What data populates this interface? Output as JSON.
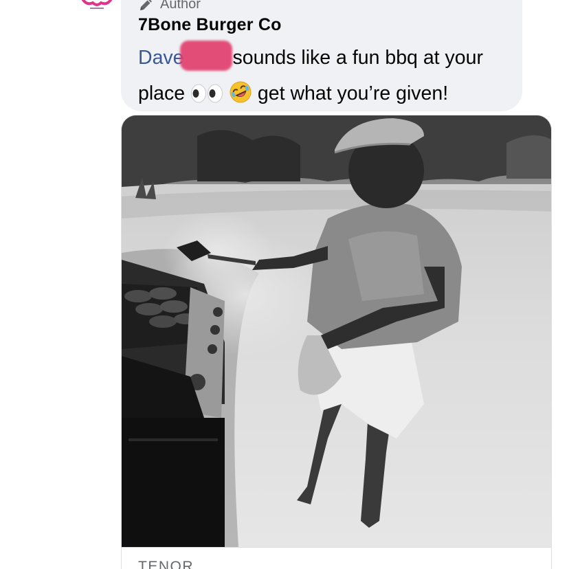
{
  "comment": {
    "badge_label": "Author",
    "author": "7Bone Burger Co",
    "mention": "Dave",
    "text_part1": "sounds like a fun bbq at your place",
    "text_part2": "get what you’re given!"
  },
  "attachment": {
    "type": "gif",
    "provider": "TENOR"
  },
  "colors": {
    "bubble": "#eff1f4",
    "mention": "#385898",
    "redaction": "#e03c6a",
    "secondary_text": "#65676b"
  }
}
